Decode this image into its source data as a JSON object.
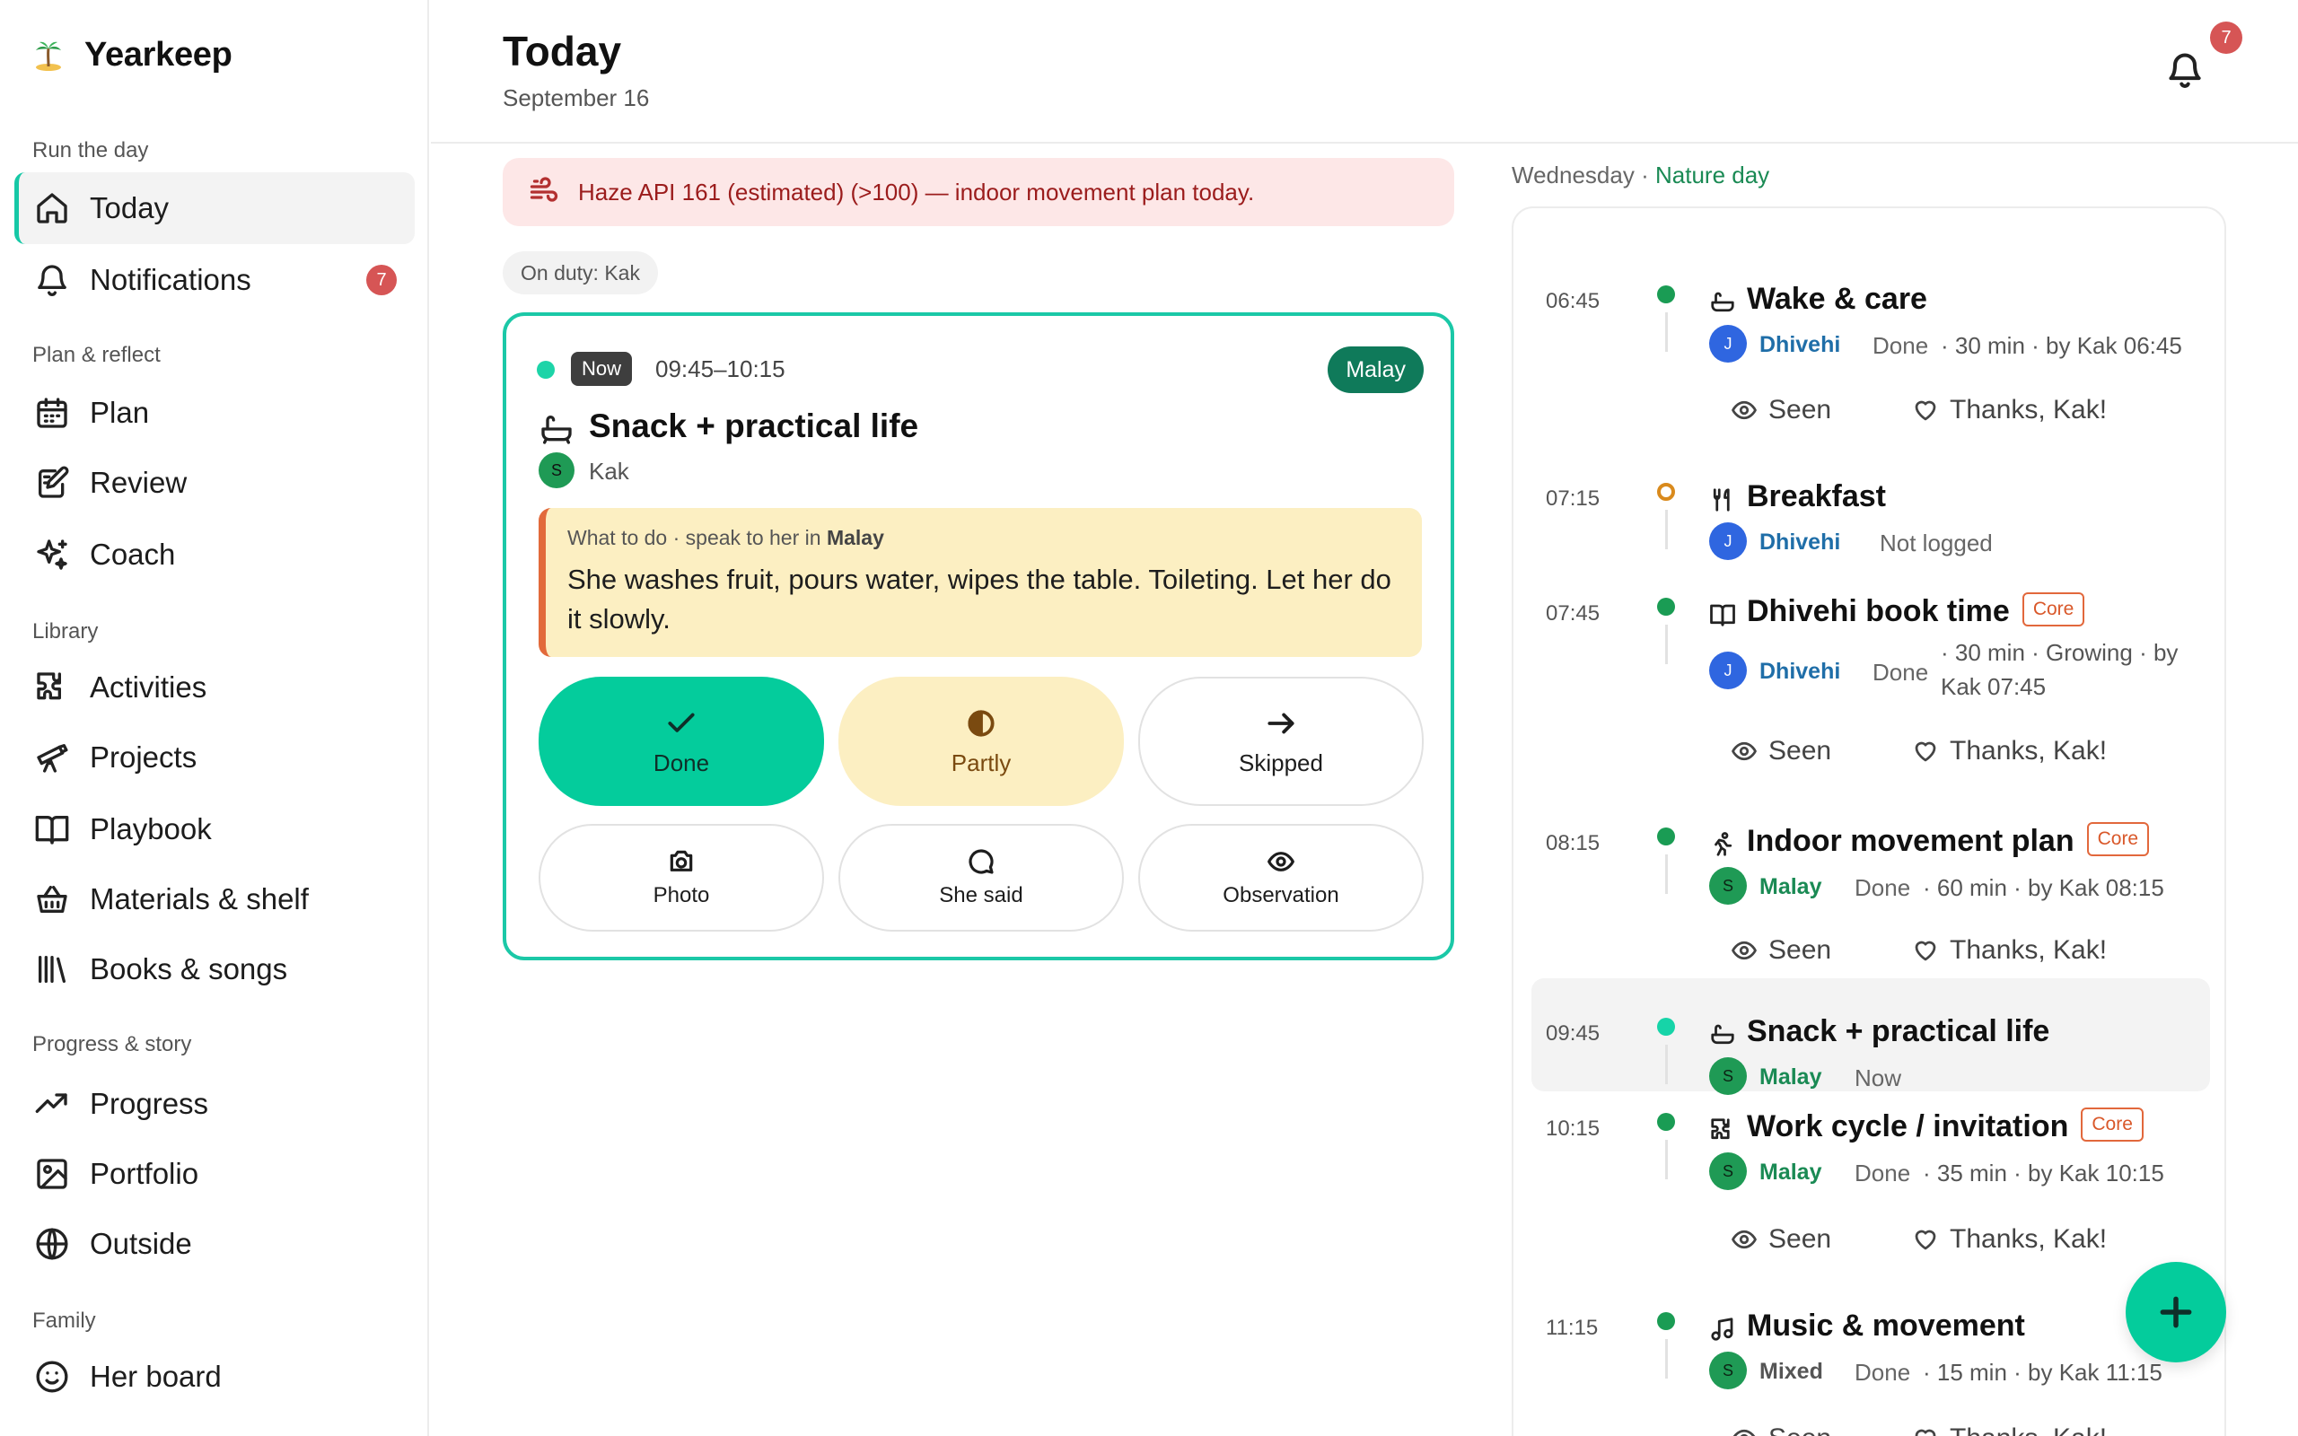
{
  "app": {
    "name": "Yearkeep"
  },
  "sidebar": {
    "sections": {
      "run": "Run the day",
      "plan": "Plan & reflect",
      "library": "Library",
      "progress": "Progress & story",
      "family": "Family"
    },
    "items": {
      "today": "Today",
      "notifications": "Notifications",
      "notifications_badge": "7",
      "plan": "Plan",
      "review": "Review",
      "coach": "Coach",
      "activities": "Activities",
      "projects": "Projects",
      "playbook": "Playbook",
      "materials": "Materials & shelf",
      "books": "Books & songs",
      "progress": "Progress",
      "portfolio": "Portfolio",
      "outside": "Outside",
      "herboard": "Her board"
    }
  },
  "header": {
    "title": "Today",
    "date": "September 16",
    "bell_badge": "7"
  },
  "alert": {
    "text": "Haze API 161 (estimated) (>100) — indoor movement plan today."
  },
  "duty": {
    "text": "On duty: Kak"
  },
  "now_card": {
    "tag": "Now",
    "time": "09:45–10:15",
    "language": "Malay",
    "title": "Snack + practical life",
    "avatar": "S",
    "by": "Kak",
    "guide_prefix": "What to do · speak to her in",
    "guide_lang": "Malay",
    "guide_body": "She washes fruit, pours water, wipes the table. Toileting. Let her do it slowly.",
    "buttons": {
      "done": "Done",
      "partly": "Partly",
      "skipped": "Skipped",
      "photo": "Photo",
      "shesaid": "She said",
      "observation": "Observation"
    }
  },
  "timeline": {
    "day": "Wednesday",
    "sep": "·",
    "kind": "Nature day",
    "entries": [
      {
        "time": "06:45",
        "name": "Wake & care",
        "avatar": "J",
        "lang": "Dhivehi",
        "status": "Done",
        "meta": "· 30 min · by Kak 06:45",
        "seen": "Seen",
        "thanks": "Thanks, Kak!"
      },
      {
        "time": "07:15",
        "name": "Breakfast",
        "avatar": "J",
        "lang": "Dhivehi",
        "status": "Not logged"
      },
      {
        "time": "07:45",
        "name": "Dhivehi book time",
        "core": "Core",
        "avatar": "J",
        "lang": "Dhivehi",
        "status": "Done",
        "meta1": "· 30 min · Growing · by",
        "meta2": "Kak 07:45",
        "seen": "Seen",
        "thanks": "Thanks, Kak!"
      },
      {
        "time": "08:15",
        "name": "Indoor movement plan",
        "core": "Core",
        "avatar": "S",
        "lang": "Malay",
        "status": "Done",
        "meta": "· 60 min · by Kak 08:15",
        "seen": "Seen",
        "thanks": "Thanks, Kak!"
      },
      {
        "time": "09:45",
        "name": "Snack + practical life",
        "avatar": "S",
        "lang": "Malay",
        "status": "Now"
      },
      {
        "time": "10:15",
        "name": "Work cycle / invitation",
        "core": "Core",
        "avatar": "S",
        "lang": "Malay",
        "status": "Done",
        "meta": "· 35 min · by Kak 10:15",
        "seen": "Seen",
        "thanks": "Thanks, Kak!"
      },
      {
        "time": "11:15",
        "name": "Music & movement",
        "avatar": "S",
        "lang": "Mixed",
        "status": "Done",
        "meta": "· 15 min · by Kak 11:15",
        "seen": "Seen",
        "thanks": "Thanks, Kak!"
      }
    ]
  },
  "colors": {
    "accent": "#04cc9c",
    "alert_bg": "#fde7e7",
    "core": "#e2683c",
    "badge": "#d65555"
  }
}
